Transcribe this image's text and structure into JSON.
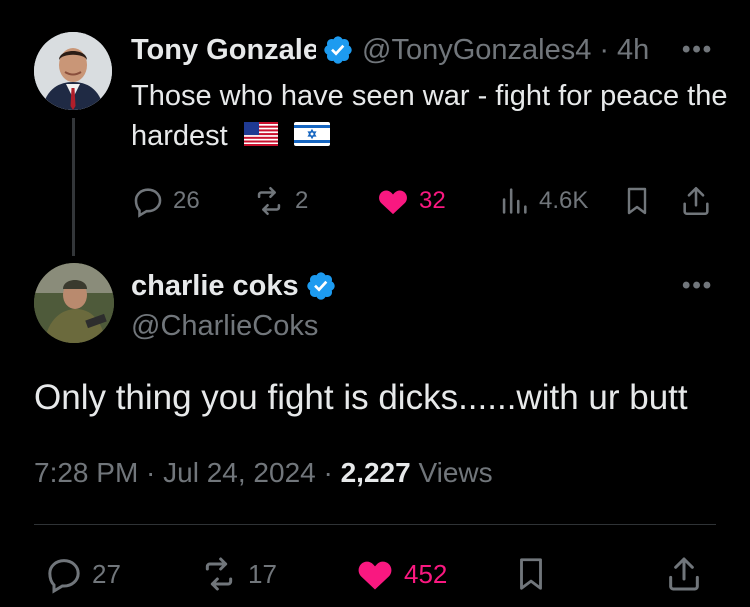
{
  "tweet1": {
    "author_name": "Tony Gonzales",
    "handle": "@TonyGonzales4",
    "time": "· 4h",
    "text": "Those who have seen war - fight for peace the hardest",
    "flags": [
      "us-flag-icon",
      "israel-flag-icon"
    ],
    "replies": "26",
    "reposts": "2",
    "likes": "32",
    "views": "4.6K",
    "verified": true
  },
  "tweet2": {
    "author_name": "charlie coks",
    "handle": "@CharlieCoks",
    "text": "Only thing you fight is dicks......with ur butt",
    "time": "7:28 PM · Jul 24, 2024 · ",
    "views_count": "2,227",
    "views_label": " Views",
    "replies": "27",
    "reposts": "17",
    "likes": "452",
    "verified": true
  },
  "colors": {
    "background": "#000000",
    "text": "#e7e9ea",
    "muted": "#71767b",
    "like": "#f91880",
    "verified": "#1d9bf0"
  }
}
